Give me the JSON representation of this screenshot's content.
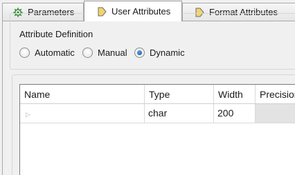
{
  "tabs": [
    {
      "label": "Parameters",
      "icon": "gear-icon",
      "active": false
    },
    {
      "label": "User Attributes",
      "icon": "attribute-arrow-icon",
      "active": true
    },
    {
      "label": "Format Attributes",
      "icon": "attribute-arrow-icon",
      "active": false
    }
  ],
  "attribute_definition": {
    "legend": "Attribute Definition",
    "options": [
      {
        "label": "Automatic",
        "selected": false
      },
      {
        "label": "Manual",
        "selected": false
      },
      {
        "label": "Dynamic",
        "selected": true
      }
    ]
  },
  "attributes_table": {
    "columns": [
      "Name",
      "Type",
      "Width",
      "Precision"
    ],
    "rows": [
      {
        "name": "",
        "type": "char",
        "width": "200",
        "precision": ""
      }
    ]
  },
  "colors": {
    "accent_radio": "#1e5e9e",
    "tab_icon_fill": "#f3d36b",
    "gear_green": "#3a8f3a"
  }
}
